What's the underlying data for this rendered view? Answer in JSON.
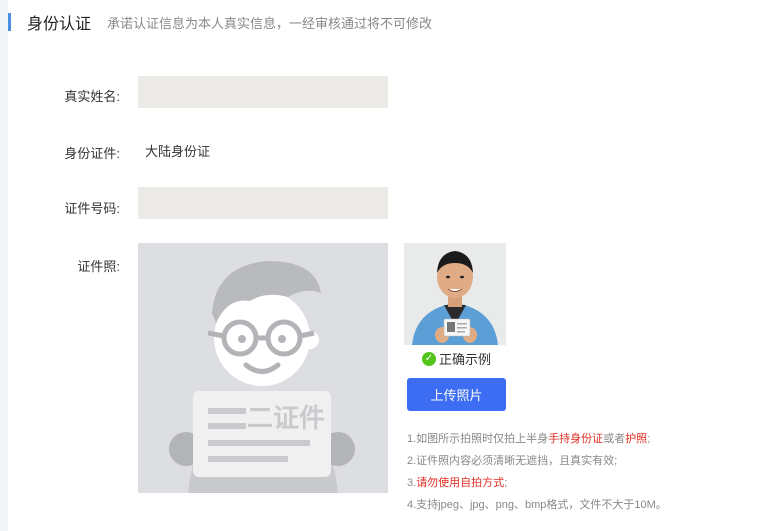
{
  "header": {
    "title": "身份认证",
    "subtitle": "承诺认证信息为本人真实信息，一经审核通过将不可修改"
  },
  "form": {
    "real_name": {
      "label": "真实姓名:",
      "value": ""
    },
    "id_type": {
      "label": "身份证件:",
      "value": "大陆身份证"
    },
    "id_number": {
      "label": "证件号码:",
      "value": ""
    },
    "id_photo": {
      "label": "证件照:",
      "placeholder_text": "二证件"
    }
  },
  "sample": {
    "caption": "正确示例",
    "check_icon": "check-circle-icon",
    "check_color": "#52c41a"
  },
  "upload": {
    "button_label": "上传照片",
    "button_color": "#3d6df2"
  },
  "tips": {
    "line1_prefix": "1.如图所示拍照时仅拍上半身",
    "line1_red1": "手持身份证",
    "line1_mid": "或者",
    "line1_red2": "护照",
    "line1_suffix": ";",
    "line2": "2.证件照内容必须清晰无遮挡，且真实有效;",
    "line3_prefix": "3.",
    "line3_red": "请勿使用自拍方式",
    "line3_suffix": ";",
    "line4": "4.支持jpeg、jpg、png、bmp格式，文件不大于10M。"
  },
  "colors": {
    "accent_bar": "#4a90e2",
    "input_bg": "#eceae6",
    "warning_red": "#e02e24"
  }
}
